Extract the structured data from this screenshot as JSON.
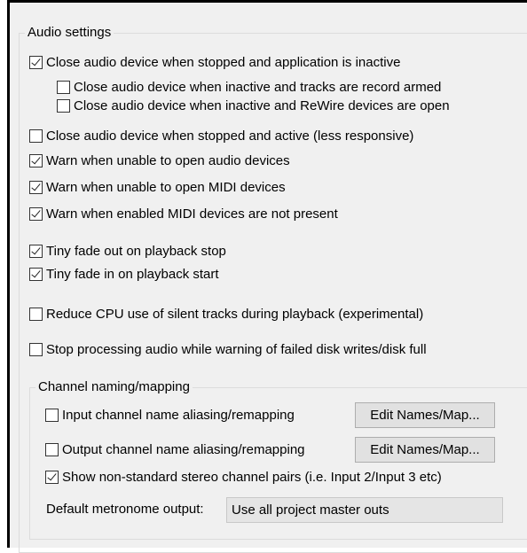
{
  "audio_settings": {
    "title": "Audio settings",
    "options": [
      {
        "label": "Close audio device when stopped and application is inactive",
        "checked": true
      },
      {
        "label": "Close audio device when inactive and tracks are record armed",
        "checked": false
      },
      {
        "label": "Close audio device when inactive and ReWire devices are open",
        "checked": false
      },
      {
        "label": "Close audio device when stopped and active (less responsive)",
        "checked": false
      },
      {
        "label": "Warn when unable to open audio devices",
        "checked": true
      },
      {
        "label": "Warn when unable to open MIDI devices",
        "checked": true
      },
      {
        "label": "Warn when enabled MIDI devices are not present",
        "checked": true
      },
      {
        "label": "Tiny fade out on playback stop",
        "checked": true
      },
      {
        "label": "Tiny fade in on playback start",
        "checked": true
      },
      {
        "label": "Reduce CPU use of silent tracks during playback (experimental)",
        "checked": false
      },
      {
        "label": "Stop processing audio while warning of failed disk writes/disk full",
        "checked": false
      }
    ]
  },
  "channel_naming": {
    "title": "Channel naming/mapping",
    "input_aliasing": {
      "label": "Input channel name aliasing/remapping",
      "checked": false
    },
    "input_edit_button": "Edit Names/Map...",
    "output_aliasing": {
      "label": "Output channel name aliasing/remapping",
      "checked": false
    },
    "output_edit_button": "Edit Names/Map...",
    "stereo_pairs": {
      "label": "Show non-standard stereo channel pairs (i.e. Input 2/Input 3 etc)",
      "checked": true
    },
    "metronome_label": "Default metronome output:",
    "metronome_value": "Use all project master outs"
  }
}
